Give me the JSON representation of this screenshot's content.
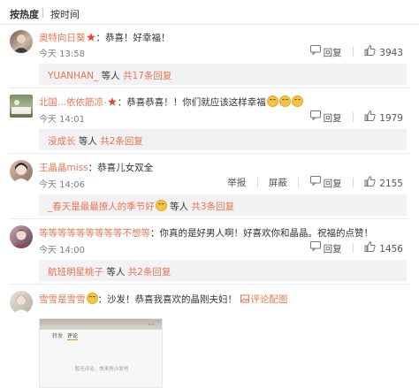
{
  "sort": {
    "hot": "按热度",
    "time": "按时间"
  },
  "colors": {
    "accent": "#eb7350",
    "muted": "#808080",
    "sub_bg": "#f2f2f5"
  },
  "comments": [
    {
      "user": "奥特向日葵",
      "badge": "star-badge-icon",
      "text": "：恭喜！好幸福！",
      "time": "今天 13:58",
      "reply": "回复",
      "likes": "3943",
      "sub": {
        "name": "YUANHAN_",
        "suffix": "等人",
        "link": "共17条回复"
      }
    },
    {
      "user": "北国...依依筋凉-",
      "badge": "star-badge-icon",
      "text": "：恭喜恭喜！！你们就应该这样幸福",
      "emoji_count": 3,
      "time": "今天 14:01",
      "reply": "回复",
      "likes": "1979",
      "sub": {
        "name": "没成长",
        "suffix": "等人",
        "link": "共2条回复"
      }
    },
    {
      "user": "王晶晶miss",
      "text": "：恭喜儿女双全",
      "time": "今天 14:06",
      "report": "举报",
      "block": "屏蔽",
      "reply": "回复",
      "likes": "2155",
      "sub": {
        "name": "_春天是最最撩人的季节好",
        "suffix": "等人",
        "link": "共3条回复"
      }
    },
    {
      "user": "等等等等等等等等等不想等",
      "text": "：你真的是好男人啊！好喜欢你和晶晶。祝福的点赞！",
      "time": "今天 14:00",
      "reply": "回复",
      "likes": "1456",
      "sub": {
        "name": "航班明星桃子",
        "suffix": "等人",
        "link": "共2条回复"
      }
    },
    {
      "user": "雪雪是雪雪",
      "text": "：沙发！恭喜我喜欢的晶刚夫妇！",
      "pic_link": "评论配图"
    }
  ],
  "preview": {
    "tab1": "转发",
    "tab2": "评论",
    "empty": "暂无评论，快来抢沙发吧"
  }
}
